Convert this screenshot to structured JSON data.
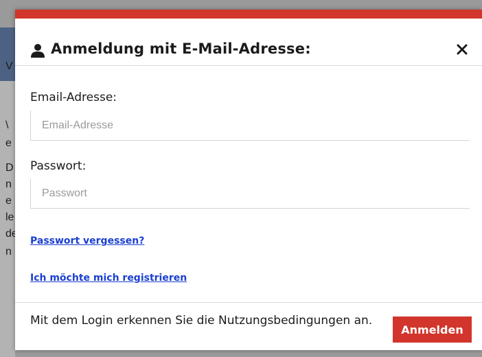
{
  "background": {
    "glyphs": [
      "V",
      "\\",
      "e",
      "D",
      "n",
      "e",
      "le",
      "de",
      "n"
    ]
  },
  "modal": {
    "title": "Anmeldung mit E-Mail-Adresse:",
    "icon": "user-icon",
    "close_icon": "close-icon",
    "accent_color": "#d1352b",
    "email": {
      "label": "Email-Adresse:",
      "placeholder": "Email-Adresse",
      "value": ""
    },
    "password": {
      "label": "Passwort:",
      "placeholder": "Passwort",
      "value": ""
    },
    "links": {
      "forgot": "Passwort vergessen?",
      "register": "Ich möchte mich registrieren"
    },
    "footer": {
      "terms_text": "Mit dem Login erkennen Sie die Nutzungsbedingungen an.",
      "submit_label": "Anmelden"
    }
  }
}
